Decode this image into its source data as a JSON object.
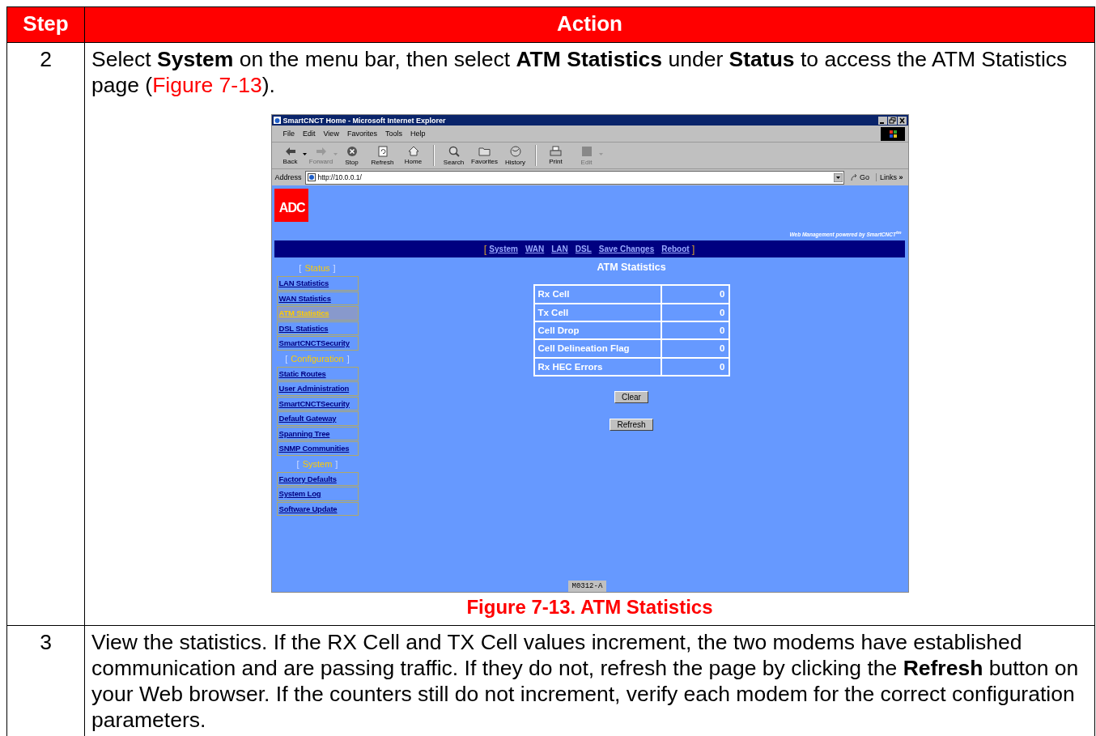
{
  "table": {
    "columns": [
      "Step",
      "Action"
    ],
    "rows": [
      {
        "step": "2",
        "parts": [
          {
            "kind": "text",
            "text": "Select **System** on the menu bar, then select **ATM Statistics** under **Status** to access the ATM Statistics page ("
          },
          {
            "kind": "link",
            "text": "Figure 7-13"
          },
          {
            "kind": "text",
            "text": ")."
          }
        ],
        "figure": {
          "caption": "Figure 7-13. ATM Statistics",
          "browser": {
            "title": "SmartCNCT Home - Microsoft Internet Explorer",
            "menu": [
              "File",
              "Edit",
              "View",
              "Favorites",
              "Tools",
              "Help"
            ],
            "toolbar": [
              [
                {
                  "kind": "back",
                  "label": "Back",
                  "disabled": false,
                  "dropdown": true
                },
                {
                  "kind": "forward",
                  "label": "Forward",
                  "disabled": true,
                  "dropdown": true
                },
                {
                  "kind": "stop",
                  "label": "Stop",
                  "disabled": false,
                  "dropdown": false
                },
                {
                  "kind": "refresh",
                  "label": "Refresh",
                  "disabled": false,
                  "dropdown": false
                },
                {
                  "kind": "home",
                  "label": "Home",
                  "disabled": false,
                  "dropdown": false
                }
              ],
              [
                {
                  "kind": "search",
                  "label": "Search",
                  "disabled": false,
                  "dropdown": false
                },
                {
                  "kind": "favorites",
                  "label": "Favorites",
                  "disabled": false,
                  "dropdown": false
                },
                {
                  "kind": "history",
                  "label": "History",
                  "disabled": false,
                  "dropdown": false
                }
              ],
              [
                {
                  "kind": "print",
                  "label": "Print",
                  "disabled": false,
                  "dropdown": false
                },
                {
                  "kind": "edit",
                  "label": "Edit",
                  "disabled": true,
                  "dropdown": true
                }
              ]
            ],
            "address_label": "Address",
            "url": "http://10.0.0.1/",
            "go": "Go",
            "links": "Links",
            "links_more": "»"
          },
          "page": {
            "logo": "ADC",
            "tagline": "Web Management powered by SmartCNCT$^{tm}$",
            "nav": {
              "open": "[",
              "items": [
                "System",
                "WAN",
                "LAN",
                "DSL",
                "Save Changes",
                "Reboot"
              ],
              "close": "]"
            },
            "sidebar": [
              {
                "kind": "heading",
                "open": "[",
                "label": "Status",
                "close": "]"
              },
              {
                "kind": "link",
                "label": "LAN Statistics",
                "selected": false
              },
              {
                "kind": "link",
                "label": "WAN Statistics",
                "selected": false
              },
              {
                "kind": "link",
                "label": "ATM Statistics",
                "selected": true
              },
              {
                "kind": "link",
                "label": "DSL Statistics",
                "selected": false
              },
              {
                "kind": "link",
                "label": "SmartCNCTSecurity",
                "selected": false
              },
              {
                "kind": "heading",
                "open": "[",
                "label": "Configuration",
                "close": "]"
              },
              {
                "kind": "link",
                "label": "Static Routes",
                "selected": false
              },
              {
                "kind": "link",
                "label": "User Administration",
                "selected": false
              },
              {
                "kind": "link",
                "label": "SmartCNCTSecurity",
                "selected": false
              },
              {
                "kind": "link",
                "label": "Default Gateway",
                "selected": false
              },
              {
                "kind": "link",
                "label": "Spanning Tree",
                "selected": false
              },
              {
                "kind": "link",
                "label": "SNMP Communities",
                "selected": false
              },
              {
                "kind": "heading",
                "open": "[",
                "label": "System",
                "close": "]"
              },
              {
                "kind": "link",
                "label": "Factory Defaults",
                "selected": false
              },
              {
                "kind": "link",
                "label": "System Log",
                "selected": false
              },
              {
                "kind": "link",
                "label": "Software Update",
                "selected": false
              }
            ],
            "title": "ATM Statistics",
            "stats": [
              {
                "name": "Rx Cell",
                "value": "0"
              },
              {
                "name": "Tx Cell",
                "value": "0"
              },
              {
                "name": "Cell Drop",
                "value": "0"
              },
              {
                "name": "Cell Delineation Flag",
                "value": "0"
              },
              {
                "name": "Rx HEC Errors",
                "value": "0"
              }
            ],
            "buttons": [
              "Clear",
              "Refresh"
            ],
            "footer_tag": "M0312-A"
          }
        }
      },
      {
        "step": "3",
        "parts": [
          {
            "kind": "text",
            "text": "View the statistics. If the RX Cell and TX Cell values increment, the two modems have established communication and are passing traffic. If they do not, refresh the page by clicking the **Refresh** button on your Web browser. If the counters still do not increment, verify each modem for the correct configuration parameters."
          }
        ]
      }
    ]
  }
}
